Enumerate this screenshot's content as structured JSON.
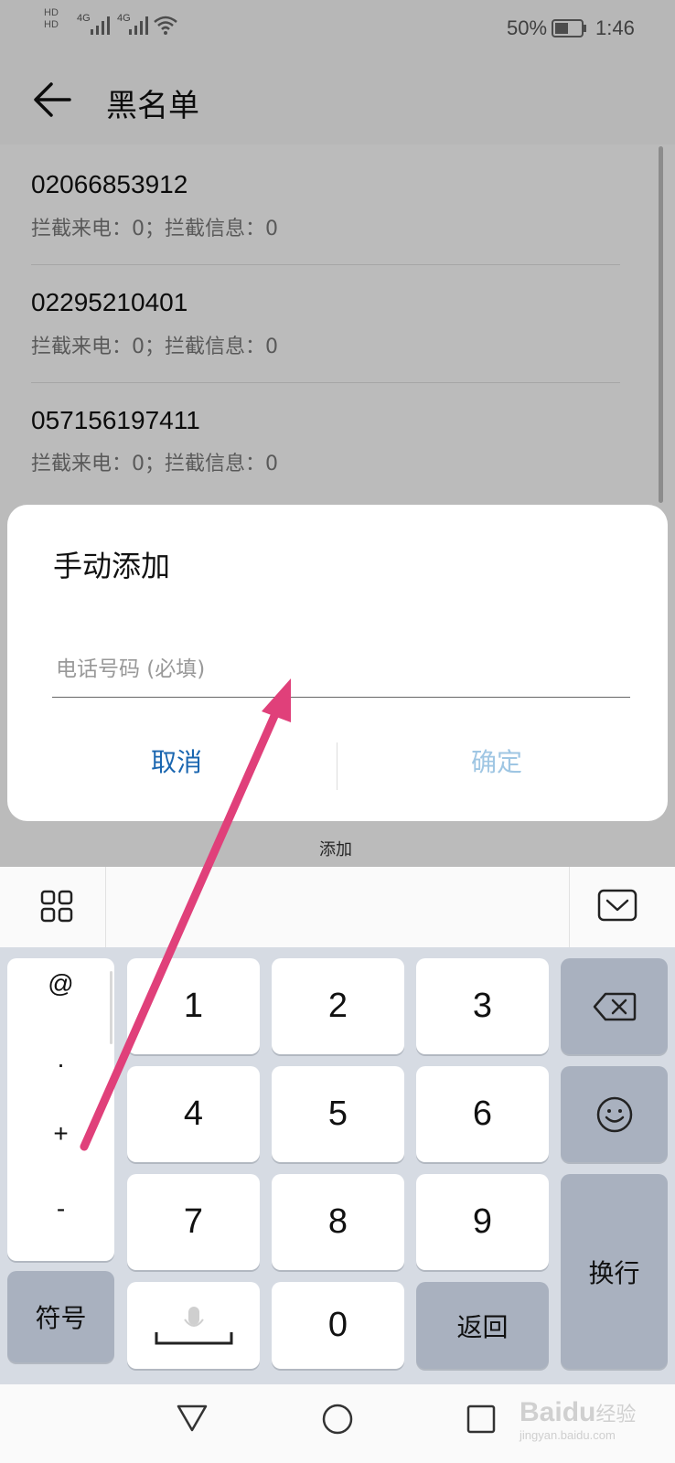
{
  "status_bar": {
    "signal_1": "4G",
    "signal_2": "4G",
    "battery": "50%",
    "time": "1:46"
  },
  "app_bar": {
    "title": "黑名单"
  },
  "blacklist": {
    "items": [
      {
        "number": "02066853912",
        "stats": "拦截来电：0；拦截信息：0"
      },
      {
        "number": "02295210401",
        "stats": "拦截来电：0；拦截信息：0"
      },
      {
        "number": "057156197411",
        "stats": "拦截来电：0；拦截信息：0"
      }
    ]
  },
  "bottom_action": {
    "label": "添加"
  },
  "dialog": {
    "title": "手动添加",
    "phone_placeholder": "电话号码 (必填)",
    "phone_value": "",
    "cancel_label": "取消",
    "confirm_label": "确定"
  },
  "keyboard": {
    "symbols": [
      "@",
      ".",
      "+",
      "-"
    ],
    "digits": [
      "1",
      "2",
      "3",
      "4",
      "5",
      "6",
      "7",
      "8",
      "9",
      "0"
    ],
    "symbol_key": "符号",
    "back_key": "返回",
    "enter_key": "换行"
  },
  "watermark": {
    "brand": "Bai",
    "brand2": "du",
    "suffix": "经验",
    "url": "jingyan.baidu.com"
  },
  "colors": {
    "accent": "#1a66b0",
    "confirm_disabled": "#9fc6e3",
    "arrow": "#e0407a"
  }
}
